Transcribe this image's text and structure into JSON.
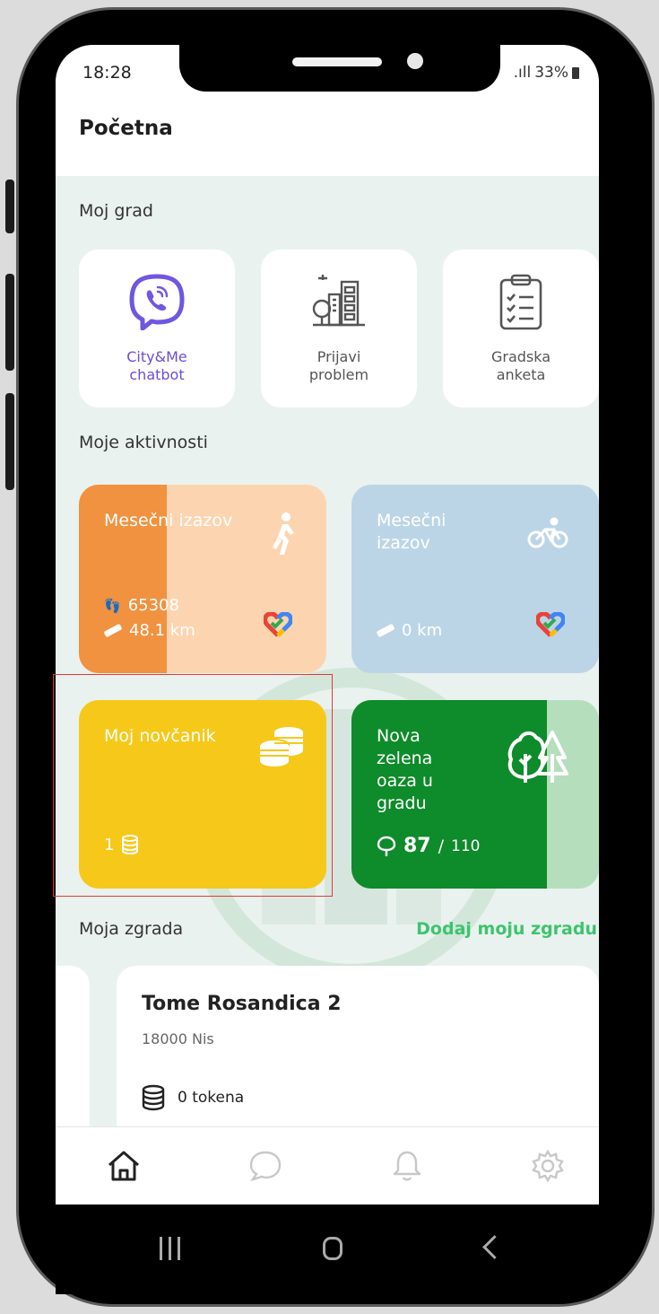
{
  "status": {
    "time": "18:28",
    "signal": ".ıll",
    "battery": "33%"
  },
  "header": {
    "title": "Početna"
  },
  "sections": {
    "my_city": "Moj grad",
    "my_activities": "Moje aktivnosti",
    "my_building": "Moja zgrada",
    "add_building": "Dodaj moju zgradu"
  },
  "tiles": [
    {
      "line1": "City&Me",
      "line2": "chatbot",
      "icon": "viber-chat-icon"
    },
    {
      "line1": "Prijavi",
      "line2": "problem",
      "icon": "city-buildings-icon"
    },
    {
      "line1": "Gradska",
      "line2": "anketa",
      "icon": "clipboard-checklist-icon"
    }
  ],
  "walk_card": {
    "title": "Mesečni izazov",
    "steps": "65308",
    "distance": "48.1 km",
    "progress": 0.36,
    "color": "#f0923f",
    "light_color": "#fcd5b0"
  },
  "bike_card": {
    "title_line1": "Mesečni",
    "title_line2": "izazov",
    "distance": "0 km",
    "color": "#bcd5e6"
  },
  "wallet_card": {
    "title": "Moj novčanik",
    "balance": "1",
    "color": "#f6c81a"
  },
  "oasis_card": {
    "title_lines": [
      "Nova",
      "zelena",
      "oaza u",
      "gradu"
    ],
    "current": "87",
    "separator": "/",
    "target": "110",
    "color": "#0e8b2a",
    "light_color": "#b5dfbc",
    "progress": 0.79
  },
  "building": {
    "name": "Tome Rosandica 2",
    "address": "18000 Nis",
    "tokens": "0 tokena"
  },
  "tabs": [
    "home-icon",
    "chat-icon",
    "bell-icon",
    "settings-icon"
  ]
}
